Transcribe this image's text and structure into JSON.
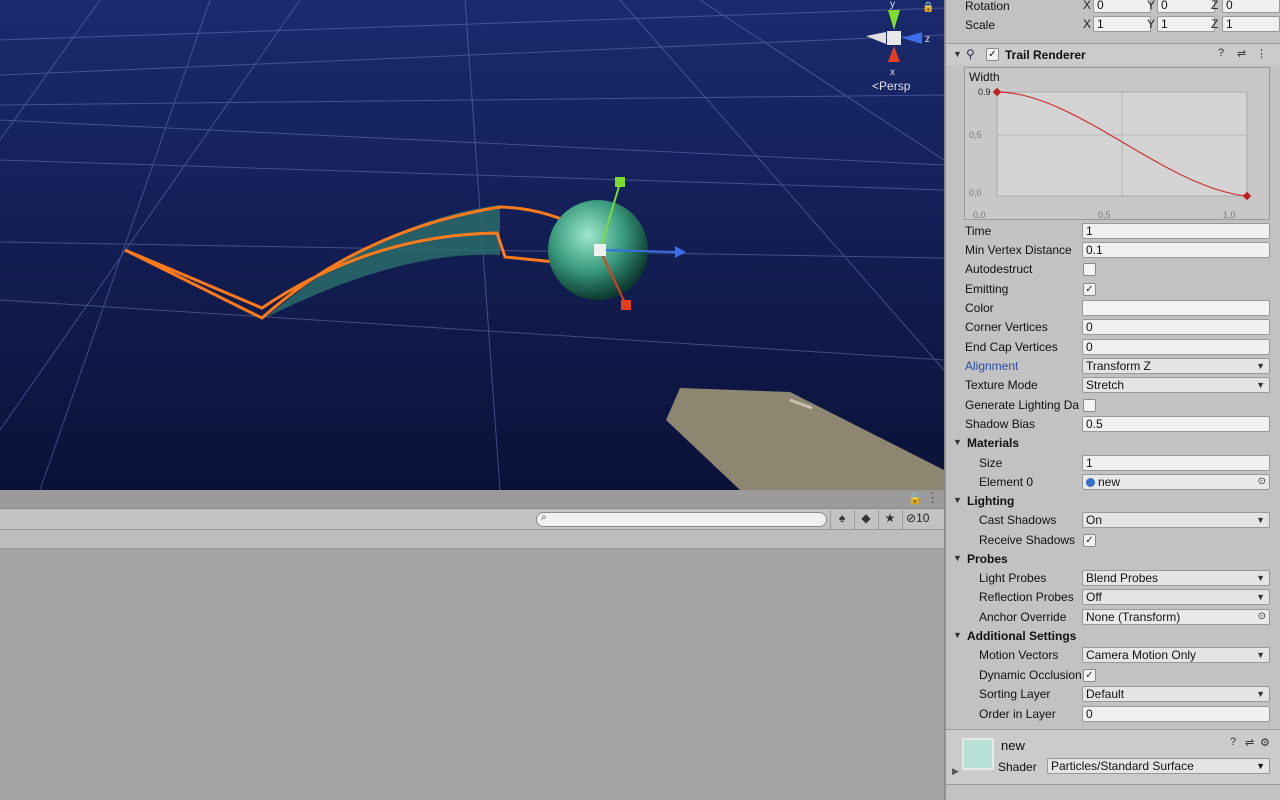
{
  "scene": {
    "persp_label": "Persp",
    "gizmo_axes": {
      "y": "y",
      "z": "z",
      "x": "x"
    }
  },
  "bottom_panel": {
    "search": {
      "value": "",
      "placeholder": ""
    },
    "hidden_count": "10"
  },
  "inspector": {
    "transform": {
      "rotation": {
        "label": "Rotation",
        "x": "0",
        "y": "0",
        "z": "0"
      },
      "scale": {
        "label": "Scale",
        "x": "1",
        "y": "1",
        "z": "1"
      },
      "axis_labels": {
        "x": "X",
        "y": "Y",
        "z": "Z"
      }
    },
    "trail_renderer": {
      "title": "Trail Renderer",
      "width_curve": {
        "caption": "Width",
        "value_label": "0.9",
        "y_ticks": [
          "0,5",
          "0,0"
        ],
        "x_ticks": [
          "0,0",
          "0,5",
          "1,0"
        ]
      },
      "fields": [
        {
          "name": "time",
          "label": "Time",
          "type": "text",
          "value": "1"
        },
        {
          "name": "min-vertex-distance",
          "label": "Min Vertex Distance",
          "type": "text",
          "value": "0.1"
        },
        {
          "name": "autodestruct",
          "label": "Autodestruct",
          "type": "check",
          "value": ""
        },
        {
          "name": "emitting",
          "label": "Emitting",
          "type": "check",
          "value": "✓"
        },
        {
          "name": "color",
          "label": "Color",
          "type": "color",
          "value": ""
        },
        {
          "name": "corner-vertices",
          "label": "Corner Vertices",
          "type": "text",
          "value": "0"
        },
        {
          "name": "end-cap-vertices",
          "label": "End Cap Vertices",
          "type": "text",
          "value": "0"
        },
        {
          "name": "alignment",
          "label": "Alignment",
          "type": "dropdown",
          "value": "Transform Z"
        },
        {
          "name": "texture-mode",
          "label": "Texture Mode",
          "type": "dropdown",
          "value": "Stretch"
        },
        {
          "name": "generate-lighting-data",
          "label": "Generate Lighting Da",
          "type": "check",
          "value": ""
        },
        {
          "name": "shadow-bias",
          "label": "Shadow Bias",
          "type": "text",
          "value": "0.5"
        }
      ],
      "materials": {
        "title": "Materials",
        "size_label": "Size",
        "size": "1",
        "element0_label": "Element 0",
        "element0": "new"
      },
      "lighting": {
        "title": "Lighting",
        "cast_label": "Cast Shadows",
        "cast": "On",
        "receive_label": "Receive Shadows",
        "receive": "✓"
      },
      "probes": {
        "title": "Probes",
        "light_label": "Light Probes",
        "light": "Blend Probes",
        "reflection_label": "Reflection Probes",
        "reflection": "Off",
        "anchor_label": "Anchor Override",
        "anchor": "None (Transform)"
      },
      "additional": {
        "title": "Additional Settings",
        "motion_label": "Motion Vectors",
        "motion": "Camera Motion Only",
        "occlusion_label": "Dynamic Occlusion",
        "occlusion": "✓",
        "sorting_label": "Sorting Layer",
        "sorting": "Default",
        "order_label": "Order in Layer",
        "order": "0"
      }
    },
    "material": {
      "name": "new",
      "shader_label": "Shader",
      "shader": "Particles/Standard Surface",
      "swatch_color": "#b7e1d7"
    }
  }
}
